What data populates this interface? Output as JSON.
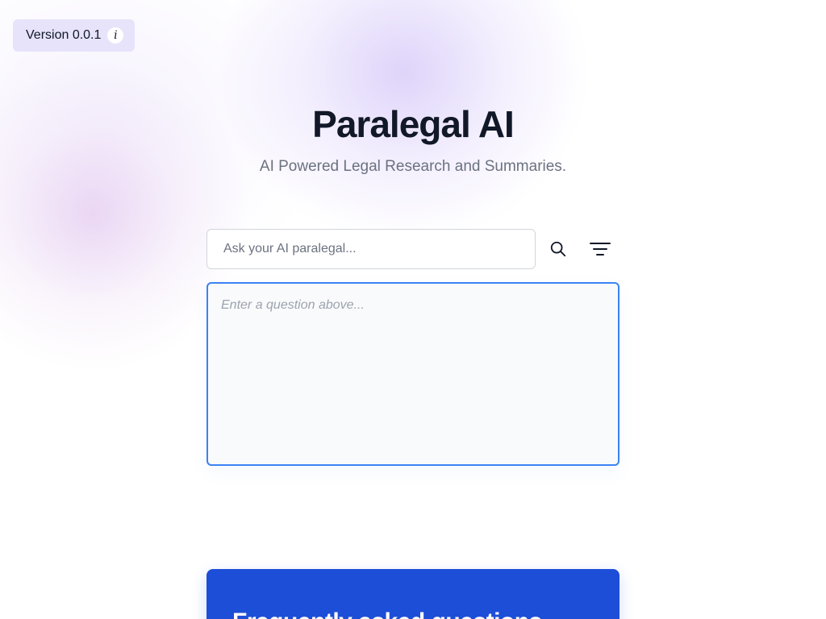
{
  "version_badge": {
    "label": "Version 0.0.1",
    "info_glyph": "i",
    "icon": "info-icon",
    "background": "#e6e3fa"
  },
  "header": {
    "title": "Paralegal AI",
    "subtitle": "AI Powered Legal Research and Summaries."
  },
  "search": {
    "placeholder": "Ask your AI paralegal...",
    "value": "",
    "search_icon": "search-icon",
    "filter_icon": "filter-icon"
  },
  "answer": {
    "placeholder": "Enter a question above...",
    "value": "",
    "border_color": "#3b82f6"
  },
  "faq": {
    "title": "Frequently asked questions",
    "background": "#1d4ed8"
  },
  "colors": {
    "text_primary": "#111827",
    "text_muted": "#6b7280",
    "accent": "#3b82f6"
  }
}
